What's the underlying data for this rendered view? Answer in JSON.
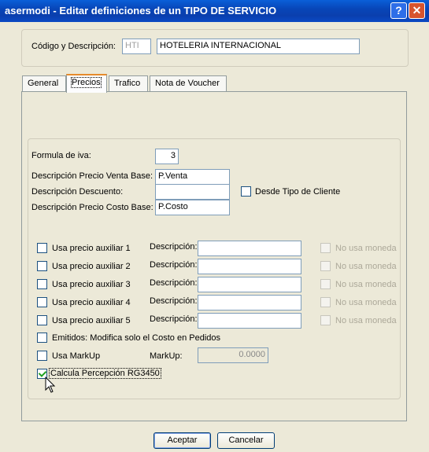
{
  "window": {
    "title": "asermodi - Editar definiciones de un TIPO DE SERVICIO",
    "help_glyph": "?",
    "close_glyph": "✕"
  },
  "header": {
    "label": "Código y Descripción:",
    "code_value": "HTI",
    "description_value": "HOTELERIA INTERNACIONAL"
  },
  "tabs": [
    {
      "label": "General",
      "active": false
    },
    {
      "label": "Precios",
      "active": true
    },
    {
      "label": "Trafico",
      "active": false
    },
    {
      "label": "Nota de Voucher",
      "active": false
    }
  ],
  "pricing": {
    "formula_label": "Formula de iva:",
    "formula_value": "3",
    "venta_label": "Descripción Precio Venta Base:",
    "venta_value": "P.Venta",
    "descuento_label": "Descripción Descuento:",
    "descuento_value": "",
    "desde_label": "Desde Tipo de Cliente",
    "costo_label": "Descripción Precio Costo Base:",
    "costo_value": "P.Costo"
  },
  "aux_prices": [
    {
      "label": "Usa precio auxiliar 1",
      "desc_label": "Descripción:",
      "value": "",
      "no_moneda": "No usa moneda"
    },
    {
      "label": "Usa precio auxiliar 2",
      "desc_label": "Descripción:",
      "value": "",
      "no_moneda": "No usa moneda"
    },
    {
      "label": "Usa precio auxiliar 3",
      "desc_label": "Descripción:",
      "value": "",
      "no_moneda": "No usa moneda"
    },
    {
      "label": "Usa precio auxiliar 4",
      "desc_label": "Descripción:",
      "value": "",
      "no_moneda": "No usa moneda"
    },
    {
      "label": "Usa precio auxiliar 5",
      "desc_label": "Descripción:",
      "value": "",
      "no_moneda": "No usa moneda"
    }
  ],
  "emitidos_label": "Emitidos: Modifica solo el Costo en Pedidos",
  "markup": {
    "label": "Usa MarkUp",
    "field_label": "MarkUp:",
    "value": "0.0000"
  },
  "percepcion": {
    "label": "Calcula Percepción RG3450",
    "checked": true
  },
  "buttons": {
    "accept": "Aceptar",
    "cancel": "Cancelar"
  },
  "colors": {
    "titlebar": "#0a4fcb",
    "background": "#ece9d8",
    "tab_accent": "#e68b2c",
    "check": "#21a121"
  }
}
